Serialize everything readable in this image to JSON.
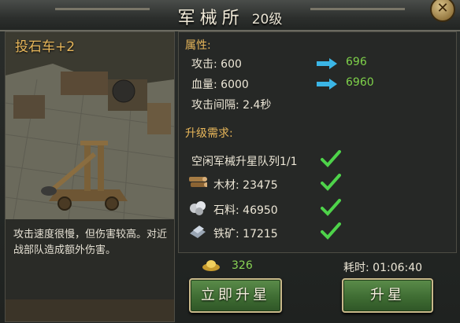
{
  "window": {
    "title": "军械所",
    "level": "20级"
  },
  "unit": {
    "name": "投石车+2",
    "description": "攻击速度很慢，但伤害较高。对近战部队造成额外伤害。"
  },
  "attributes": {
    "header": "属性:",
    "attack": {
      "label": "攻击: 600",
      "next": "696"
    },
    "hp": {
      "label": "血量: 6000",
      "next": "6960"
    },
    "interval": {
      "label": "攻击间隔: 2.4秒"
    }
  },
  "requirements": {
    "header": "升级需求:",
    "queue": "空闲军械升星队列1/1",
    "wood": "木材: 23475",
    "stone": "石料: 46950",
    "iron": "铁矿: 17215"
  },
  "cost": {
    "gold": "326",
    "time": "耗时: 01:06:40"
  },
  "buttons": {
    "instant": "立即升星",
    "upgrade": "升星"
  },
  "icons": {
    "close": "close-icon",
    "arrow": "arrow-right-icon",
    "check": "checkmark-icon",
    "wood": "wood-icon",
    "stone": "stone-icon",
    "iron": "iron-icon",
    "gold": "gold-ingot-icon"
  },
  "colors": {
    "accent": "#e7b65a",
    "positive": "#7fd24a",
    "button": "#3f6d33",
    "arrow": "#3bb6e6"
  }
}
